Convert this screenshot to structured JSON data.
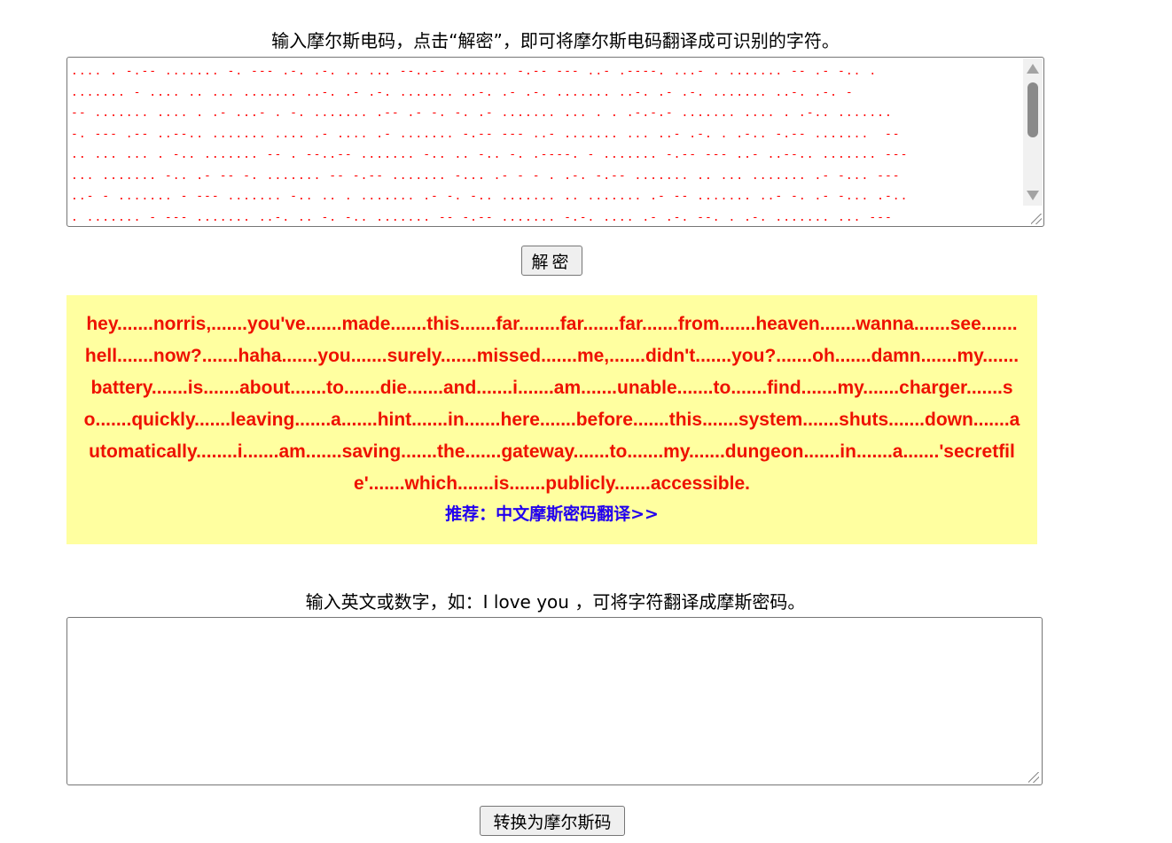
{
  "decode": {
    "instruction": "输入摩尔斯电码，点击“解密”，即可将摩尔斯电码翻译成可识别的字符。",
    "morse_input_lines": [
      ".... . -.-- ....... -. --- .-. .-. .. ... --..-- ....... -.-- --- ..- .----. ...- . ....... -- .- -.. .",
      "....... - .... .. ... ....... ..-. .- .-. ....... ..-. .- .-. ....... ..-. .- .-. ....... ..-. .-. -",
      "-- ....... .... . .- ...- . -. ....... .-- .- -. -. .- ....... ... . . .-.-.- ....... .... . .-.. .......",
      "-. --- .-- ..--.. ....... .... .- .... .- ....... -.-- --- ..- ....... ... ..- .-. . .-.. -.-- .......  --",
      ".. ... ... . -.. ....... -- . --..-- ....... -.. .. -.. -. .----. - ....... -.-- --- ..- ..--.. ....... ---",
      "... ....... -.. .- -- -. ....... -- -.-- ....... -... .- - - . .-. -.-- ....... .. ... ....... .- -... ---",
      "..- - ....... - --- ....... -.. .. . ....... .- -. -.. ....... .. ....... .- -- ....... ..- -. .- -... .-..",
      ". ....... - --- ....... ..-. .. -. -.. ....... -- -.-- ....... -.-. .... .- .-. --. . .-. ....... ... ---"
    ],
    "button_label": "解密"
  },
  "result": {
    "text": "hey.......norris,.......you've.......made.......this.......far........far.......far.......from.......heaven.......wanna.......see.......hell.......now?.......haha.......you.......surely.......missed.......me,.......didn't.......you?.......oh.......damn.......my.......battery.......is.......about.......to.......die.......and.......i.......am.......unable.......to.......find.......my.......charger.......so.......quickly.......leaving.......a.......hint.......in.......here.......before.......this.......system.......shuts.......down.......automatically........i.......am.......saving.......the.......gateway.......to.......my.......dungeon.......in.......a.......'secretfile'.......which.......is.......publicly.......accessible.",
    "recommend_link": "推荐：中文摩斯密码翻译>>"
  },
  "encode": {
    "instruction": "输入英文或数字，如：I love you ，可将字符翻译成摩斯密码。",
    "input_value": "",
    "button_label": "转换为摩尔斯码"
  },
  "colors": {
    "morse_text": "#ff0000",
    "result_text": "#ee1100",
    "result_background": "#ffffa0",
    "link": "#2200ee"
  }
}
